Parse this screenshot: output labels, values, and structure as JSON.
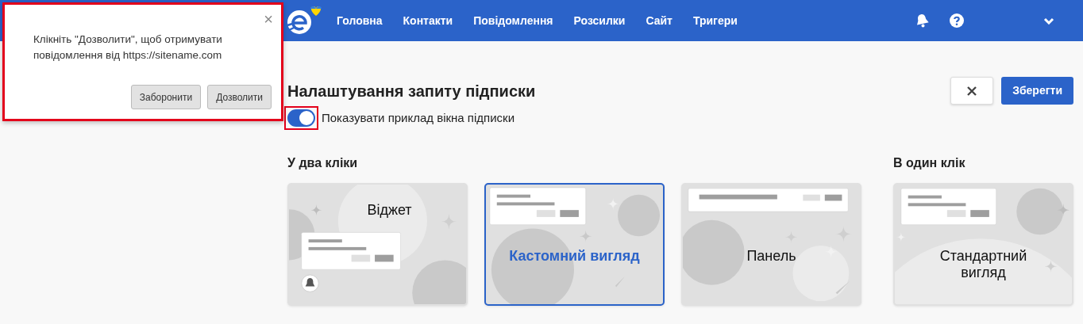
{
  "navbar": {
    "items": [
      {
        "label": "Головна"
      },
      {
        "label": "Контакти"
      },
      {
        "label": "Повідомлення"
      },
      {
        "label": "Розсилки"
      },
      {
        "label": "Сайт"
      },
      {
        "label": "Тригери"
      }
    ]
  },
  "page": {
    "title": "Налаштування запиту підписки",
    "save_button": "Зберегти"
  },
  "toggle": {
    "label": "Показувати приклад вікна підписки",
    "on": true,
    "highlighted": true
  },
  "groups": [
    {
      "title": "У два кліки",
      "options": [
        {
          "kind": "widget",
          "label": "Віджет",
          "selected": false
        },
        {
          "kind": "custom",
          "label": "Кастомний вигляд",
          "selected": true
        },
        {
          "kind": "panel",
          "label": "Панель",
          "selected": false
        }
      ]
    },
    {
      "title": "В один клік",
      "options": [
        {
          "kind": "standard",
          "label": "Стандартний вигляд",
          "selected": false
        }
      ]
    }
  ],
  "permission_popup": {
    "message": "Клікніть \"Дозволити\", щоб отримувати повідомлення від https://sitename.com",
    "close": "×",
    "buttons": [
      "Заборонити",
      "Дозволити"
    ],
    "highlighted": true
  }
}
